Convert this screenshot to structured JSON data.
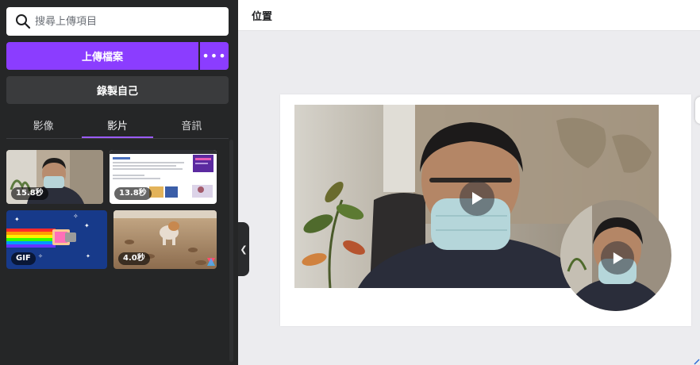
{
  "search": {
    "placeholder": "搜尋上傳項目",
    "value": ""
  },
  "upload": {
    "label": "上傳檔案",
    "more_label": "•••"
  },
  "record": {
    "label": "錄製自己"
  },
  "tabs": [
    {
      "label": "影像",
      "active": false
    },
    {
      "label": "影片",
      "active": true
    },
    {
      "label": "音訊",
      "active": false
    }
  ],
  "media": [
    {
      "badge": "15.8秒",
      "kind": "webcam-recording"
    },
    {
      "badge": "13.8秒",
      "kind": "document-recording"
    },
    {
      "badge": "GIF",
      "kind": "nyan-cat-gif"
    },
    {
      "badge": "4.0秒",
      "kind": "dog-on-beach"
    }
  ],
  "editor": {
    "section_title": "位置"
  },
  "colors": {
    "accent": "#8b3dff",
    "panel": "#252627",
    "tab_underline": "#9b5cff",
    "canvas_bg": "#ececef"
  }
}
